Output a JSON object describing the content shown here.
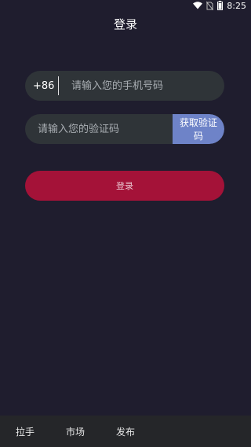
{
  "status": {
    "time": "8:25",
    "icons": [
      "wifi-icon",
      "no-sim-icon",
      "battery-icon"
    ]
  },
  "page": {
    "title": "登录"
  },
  "phone": {
    "prefix": "+86",
    "placeholder": "请输入您的手机号码"
  },
  "code": {
    "placeholder": "请输入您的验证码",
    "button_label": "获取验证码"
  },
  "login": {
    "label": "登录"
  },
  "nav": {
    "items": [
      {
        "label": "拉手"
      },
      {
        "label": "市场"
      },
      {
        "label": "发布"
      }
    ]
  },
  "colors": {
    "background": "#1f1d2e",
    "input_bg": "#2f3438",
    "code_button": "#6e83c8",
    "login_button": "#a41238",
    "nav_bg": "#252629"
  }
}
